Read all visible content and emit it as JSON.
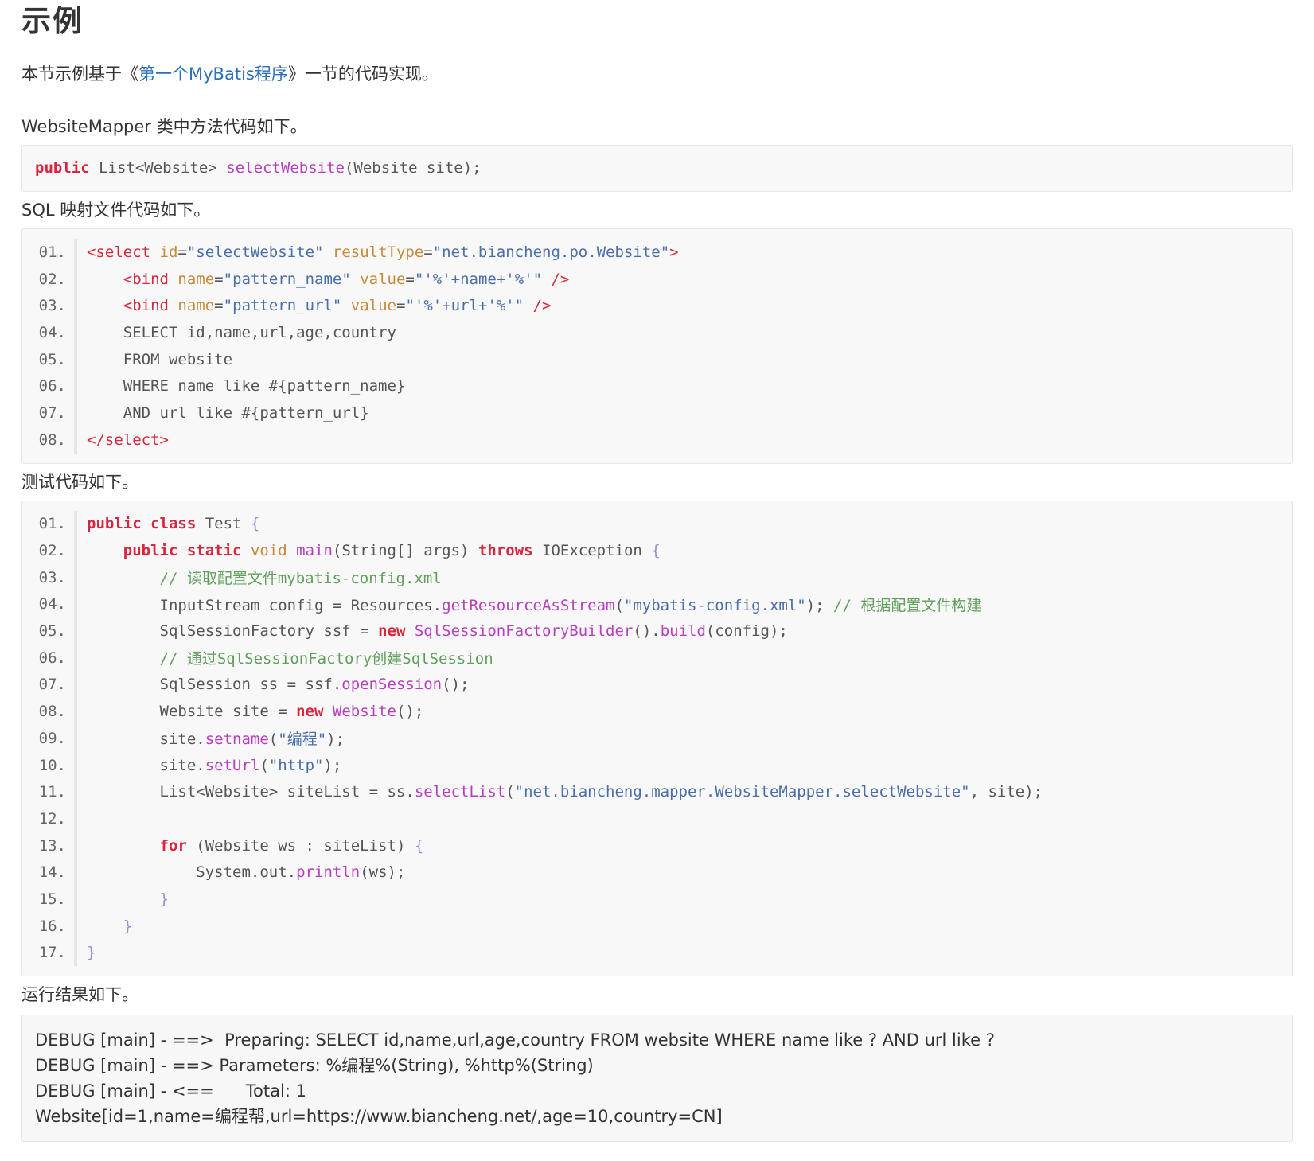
{
  "heading": "示例",
  "intro": {
    "before": "本节示例基于《",
    "link": "第一个MyBatis程序",
    "after": "》一节的代码实现。"
  },
  "label_mapper": "WebsiteMapper 类中方法代码如下。",
  "mapper_code": {
    "kw": "public",
    "type": "List<Website>",
    "fn": "selectWebsite",
    "rest": "(Website site);"
  },
  "label_sql": "SQL 映射文件代码如下。",
  "sql_lines": [
    {
      "no": "01.",
      "indent": "",
      "parts": [
        [
          "tag",
          "<select "
        ],
        [
          "attr",
          "id"
        ],
        [
          "type",
          "="
        ],
        [
          "str",
          "\"selectWebsite\" "
        ],
        [
          "attr",
          "resultType"
        ],
        [
          "type",
          "="
        ],
        [
          "str",
          "\"net.biancheng.po.Website\""
        ],
        [
          "tag",
          ">"
        ]
      ]
    },
    {
      "no": "02.",
      "indent": "    ",
      "parts": [
        [
          "tag",
          "<bind "
        ],
        [
          "attr",
          "name"
        ],
        [
          "type",
          "="
        ],
        [
          "str",
          "\"pattern_name\" "
        ],
        [
          "attr",
          "value"
        ],
        [
          "type",
          "="
        ],
        [
          "str",
          "\"'%'+name+'%'\" "
        ],
        [
          "tag",
          "/>"
        ]
      ]
    },
    {
      "no": "03.",
      "indent": "    ",
      "parts": [
        [
          "tag",
          "<bind "
        ],
        [
          "attr",
          "name"
        ],
        [
          "type",
          "="
        ],
        [
          "str",
          "\"pattern_url\" "
        ],
        [
          "attr",
          "value"
        ],
        [
          "type",
          "="
        ],
        [
          "str",
          "\"'%'+url+'%'\" "
        ],
        [
          "tag",
          "/>"
        ]
      ]
    },
    {
      "no": "04.",
      "indent": "    ",
      "parts": [
        [
          "type",
          "SELECT id,name,url,age,country"
        ]
      ]
    },
    {
      "no": "05.",
      "indent": "    ",
      "parts": [
        [
          "type",
          "FROM website"
        ]
      ]
    },
    {
      "no": "06.",
      "indent": "    ",
      "parts": [
        [
          "type",
          "WHERE name like #{pattern_name}"
        ]
      ]
    },
    {
      "no": "07.",
      "indent": "    ",
      "parts": [
        [
          "type",
          "AND url like #{pattern_url}"
        ]
      ]
    },
    {
      "no": "08.",
      "indent": "",
      "parts": [
        [
          "tag",
          "</select>"
        ]
      ]
    }
  ],
  "label_test": "测试代码如下。",
  "test_lines": [
    {
      "no": "01.",
      "indent": "",
      "parts": [
        [
          "kw",
          "public class "
        ],
        [
          "type",
          "Test "
        ],
        [
          "punc",
          "{"
        ]
      ]
    },
    {
      "no": "02.",
      "indent": "    ",
      "parts": [
        [
          "kw",
          "public static "
        ],
        [
          "attr",
          "void "
        ],
        [
          "fn",
          "main"
        ],
        [
          "type",
          "(String[] args) "
        ],
        [
          "kw",
          "throws "
        ],
        [
          "type",
          "IOException "
        ],
        [
          "punc",
          "{"
        ]
      ]
    },
    {
      "no": "03.",
      "indent": "        ",
      "parts": [
        [
          "cmt",
          "// 读取配置文件mybatis-config.xml"
        ]
      ]
    },
    {
      "no": "04.",
      "indent": "        ",
      "parts": [
        [
          "type",
          "InputStream config = Resources."
        ],
        [
          "fn",
          "getResourceAsStream"
        ],
        [
          "type",
          "("
        ],
        [
          "str",
          "\"mybatis-config.xml\""
        ],
        [
          "type",
          "); "
        ],
        [
          "cmt",
          "// 根据配置文件构建"
        ]
      ]
    },
    {
      "no": "05.",
      "indent": "        ",
      "parts": [
        [
          "type",
          "SqlSessionFactory ssf = "
        ],
        [
          "kw",
          "new "
        ],
        [
          "fn",
          "SqlSessionFactoryBuilder"
        ],
        [
          "type",
          "()."
        ],
        [
          "fn",
          "build"
        ],
        [
          "type",
          "(config);"
        ]
      ]
    },
    {
      "no": "06.",
      "indent": "        ",
      "parts": [
        [
          "cmt",
          "// 通过SqlSessionFactory创建SqlSession"
        ]
      ]
    },
    {
      "no": "07.",
      "indent": "        ",
      "parts": [
        [
          "type",
          "SqlSession ss = ssf."
        ],
        [
          "fn",
          "openSession"
        ],
        [
          "type",
          "();"
        ]
      ]
    },
    {
      "no": "08.",
      "indent": "        ",
      "parts": [
        [
          "type",
          "Website site = "
        ],
        [
          "kw",
          "new "
        ],
        [
          "fn",
          "Website"
        ],
        [
          "type",
          "();"
        ]
      ]
    },
    {
      "no": "09.",
      "indent": "        ",
      "parts": [
        [
          "type",
          "site."
        ],
        [
          "fn",
          "setname"
        ],
        [
          "type",
          "("
        ],
        [
          "str",
          "\"编程\""
        ],
        [
          "type",
          ");"
        ]
      ]
    },
    {
      "no": "10.",
      "indent": "        ",
      "parts": [
        [
          "type",
          "site."
        ],
        [
          "fn",
          "setUrl"
        ],
        [
          "type",
          "("
        ],
        [
          "str",
          "\"http\""
        ],
        [
          "type",
          ");"
        ]
      ]
    },
    {
      "no": "11.",
      "indent": "        ",
      "parts": [
        [
          "type",
          "List<Website> siteList = ss."
        ],
        [
          "fn",
          "selectList"
        ],
        [
          "type",
          "("
        ],
        [
          "str",
          "\"net.biancheng.mapper.WebsiteMapper.selectWebsite\""
        ],
        [
          "type",
          ", site);"
        ]
      ]
    },
    {
      "no": "12.",
      "indent": "",
      "parts": []
    },
    {
      "no": "13.",
      "indent": "        ",
      "parts": [
        [
          "kw",
          "for "
        ],
        [
          "type",
          "(Website ws : siteList) "
        ],
        [
          "punc",
          "{"
        ]
      ]
    },
    {
      "no": "14.",
      "indent": "            ",
      "parts": [
        [
          "type",
          "System.out."
        ],
        [
          "fn",
          "println"
        ],
        [
          "type",
          "(ws);"
        ]
      ]
    },
    {
      "no": "15.",
      "indent": "        ",
      "parts": [
        [
          "punc",
          "}"
        ]
      ]
    },
    {
      "no": "16.",
      "indent": "    ",
      "parts": [
        [
          "punc",
          "}"
        ]
      ]
    },
    {
      "no": "17.",
      "indent": "",
      "parts": [
        [
          "punc",
          "}"
        ]
      ]
    }
  ],
  "label_result": "运行结果如下。",
  "result_lines": [
    "DEBUG [main] - ==>  Preparing: SELECT id,name,url,age,country FROM website WHERE name like ? AND url like ?",
    "DEBUG [main] - ==> Parameters: %编程%(String), %http%(String)",
    "DEBUG [main] - <==      Total: 1",
    "Website[id=1,name=编程帮,url=https://www.biancheng.net/,age=10,country=CN]"
  ]
}
